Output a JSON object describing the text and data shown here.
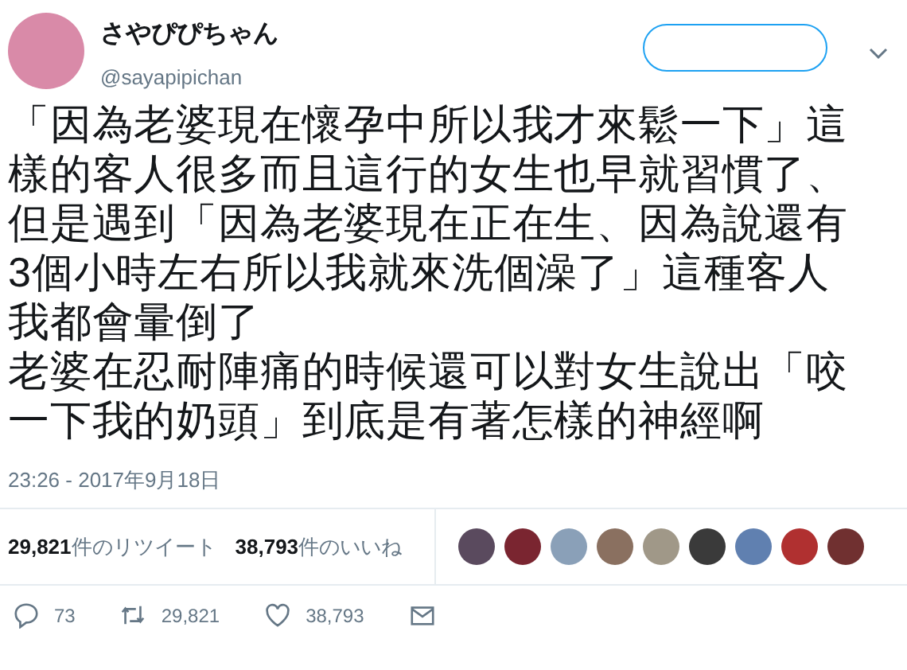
{
  "author": {
    "name": "さやぴぴちゃん",
    "handle": "@sayapipichan"
  },
  "tweet": {
    "paragraphs": [
      "「因為老婆現在懷孕中所以我才來鬆一下」這樣的客人很多而且這行的女生也早就習慣了、但是遇到「因為老婆現在正在生、因為說還有3個小時左右所以我就來洗個澡了」這種客人我都會暈倒了",
      "老婆在忍耐陣痛的時候還可以對女生說出「咬一下我的奶頭」到底是有著怎樣的神經啊"
    ],
    "timestamp": "23:26 - 2017年9月18日"
  },
  "stats": [
    {
      "count": "29,821",
      "label": "件のリツイート"
    },
    {
      "count": "38,793",
      "label": "件のいいね"
    }
  ],
  "actions": [
    {
      "kind": "reply",
      "count": "73"
    },
    {
      "kind": "retweet",
      "count": "29,821"
    },
    {
      "kind": "like",
      "count": "38,793"
    },
    {
      "kind": "message"
    }
  ]
}
